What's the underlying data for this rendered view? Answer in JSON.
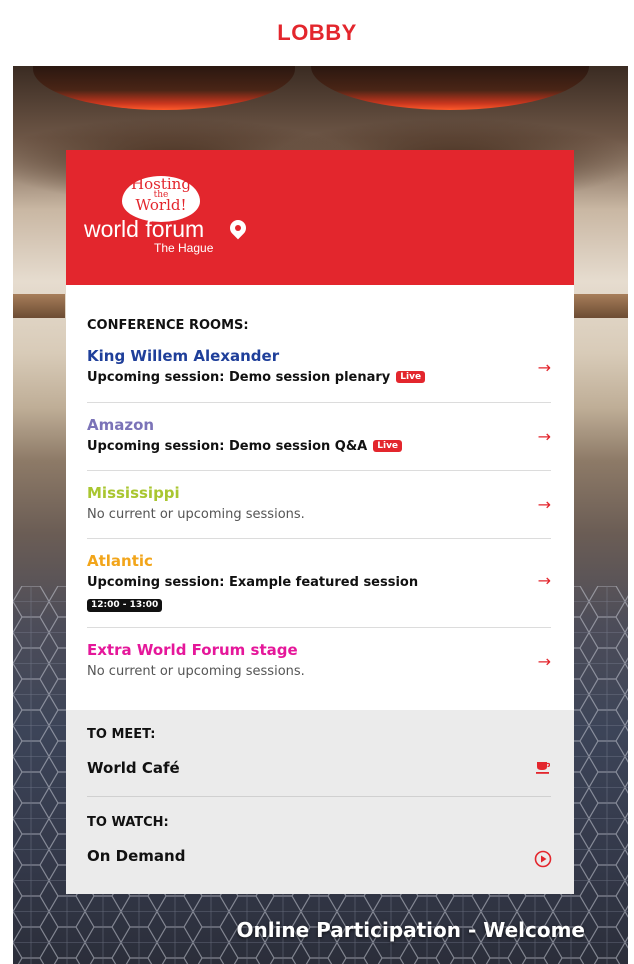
{
  "header": {
    "title": "LOBBY"
  },
  "logo": {
    "tagline_top": "Hosting",
    "tagline_mid": "the",
    "tagline_bottom": "World!",
    "brand": "world forum",
    "location": "The Hague"
  },
  "conference": {
    "label": "CONFERENCE ROOMS:",
    "rooms": [
      {
        "name": "King Willem Alexander",
        "color": "#1f3f9a",
        "session": "Upcoming session: Demo session plenary",
        "badge": "Live"
      },
      {
        "name": "Amazon",
        "color": "#7b73b8",
        "session": "Upcoming session: Demo session Q&A",
        "badge": "Live"
      },
      {
        "name": "Mississippi",
        "color": "#a9c630",
        "status": "No current or upcoming sessions."
      },
      {
        "name": "Atlantic",
        "color": "#f2a51a",
        "session": "Upcoming session: Example featured session",
        "time": "12:00 - 13:00"
      },
      {
        "name": "Extra World Forum stage",
        "color": "#e5179a",
        "status": "No current or upcoming sessions."
      }
    ]
  },
  "meet": {
    "label": "TO MEET:",
    "name": "World Café",
    "icon": "coffee-cup-icon"
  },
  "watch": {
    "label": "TO WATCH:",
    "name": "On Demand",
    "icon": "play-circle-icon"
  },
  "footer": {
    "welcome": "Online Participation - Welcome"
  },
  "colors": {
    "brand_red": "#e3262d",
    "gray_panel": "#ebebeb"
  }
}
